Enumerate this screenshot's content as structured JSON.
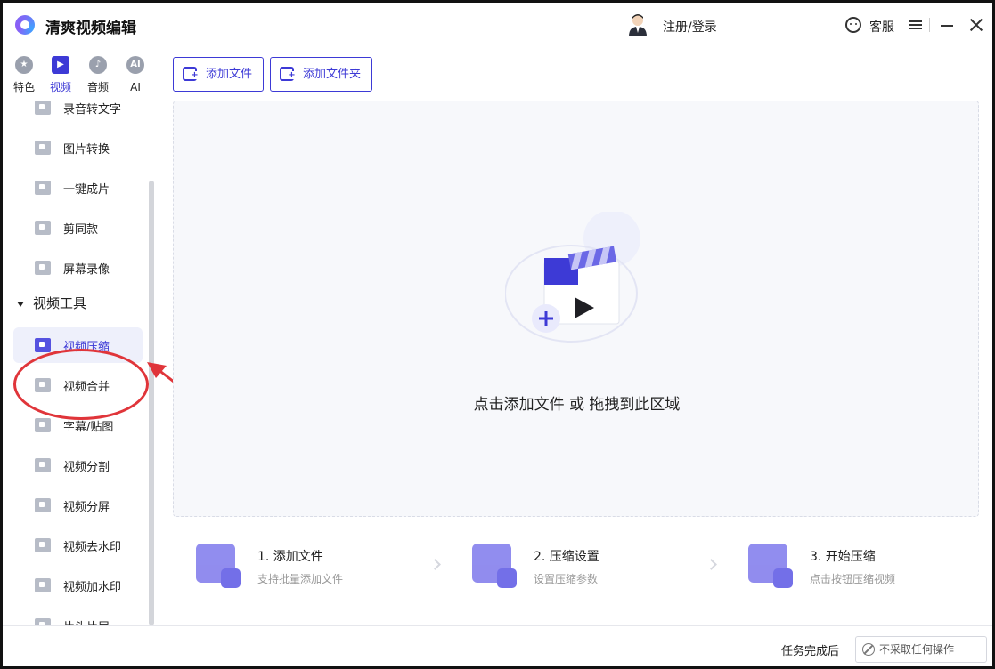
{
  "app": {
    "title": "清爽视频编辑"
  },
  "header": {
    "login_label": "注册/登录",
    "service_label": "客服"
  },
  "sidebar": {
    "tabs": [
      {
        "label": "特色",
        "icon": "star-icon"
      },
      {
        "label": "视频",
        "icon": "video-icon",
        "active": true
      },
      {
        "label": "音频",
        "icon": "audio-icon"
      },
      {
        "label": "AI",
        "icon": "ai-icon",
        "glyph": "AI"
      }
    ],
    "items_top": [
      {
        "label": "录音转文字"
      },
      {
        "label": "图片转换"
      },
      {
        "label": "一键成片"
      },
      {
        "label": "剪同款"
      },
      {
        "label": "屏幕录像"
      }
    ],
    "group_title": "视频工具",
    "items_tools": [
      {
        "label": "视频压缩",
        "active": true
      },
      {
        "label": "视频合并"
      },
      {
        "label": "字幕/贴图"
      },
      {
        "label": "视频分割"
      },
      {
        "label": "视频分屏"
      },
      {
        "label": "视频去水印"
      },
      {
        "label": "视频加水印"
      },
      {
        "label": "片头片尾"
      }
    ]
  },
  "toolbar": {
    "add_file_label": "添加文件",
    "add_folder_label": "添加文件夹"
  },
  "dropzone": {
    "hint": "点击添加文件 或 拖拽到此区域"
  },
  "steps": [
    {
      "title": "1. 添加文件",
      "desc": "支持批量添加文件"
    },
    {
      "title": "2. 压缩设置",
      "desc": "设置压缩参数"
    },
    {
      "title": "3. 开始压缩",
      "desc": "点击按钮压缩视频"
    }
  ],
  "statusbar": {
    "label": "任务完成后",
    "select_value": "不采取任何操作"
  },
  "colors": {
    "accent": "#3d3ad6",
    "annotation": "#e0353a"
  }
}
